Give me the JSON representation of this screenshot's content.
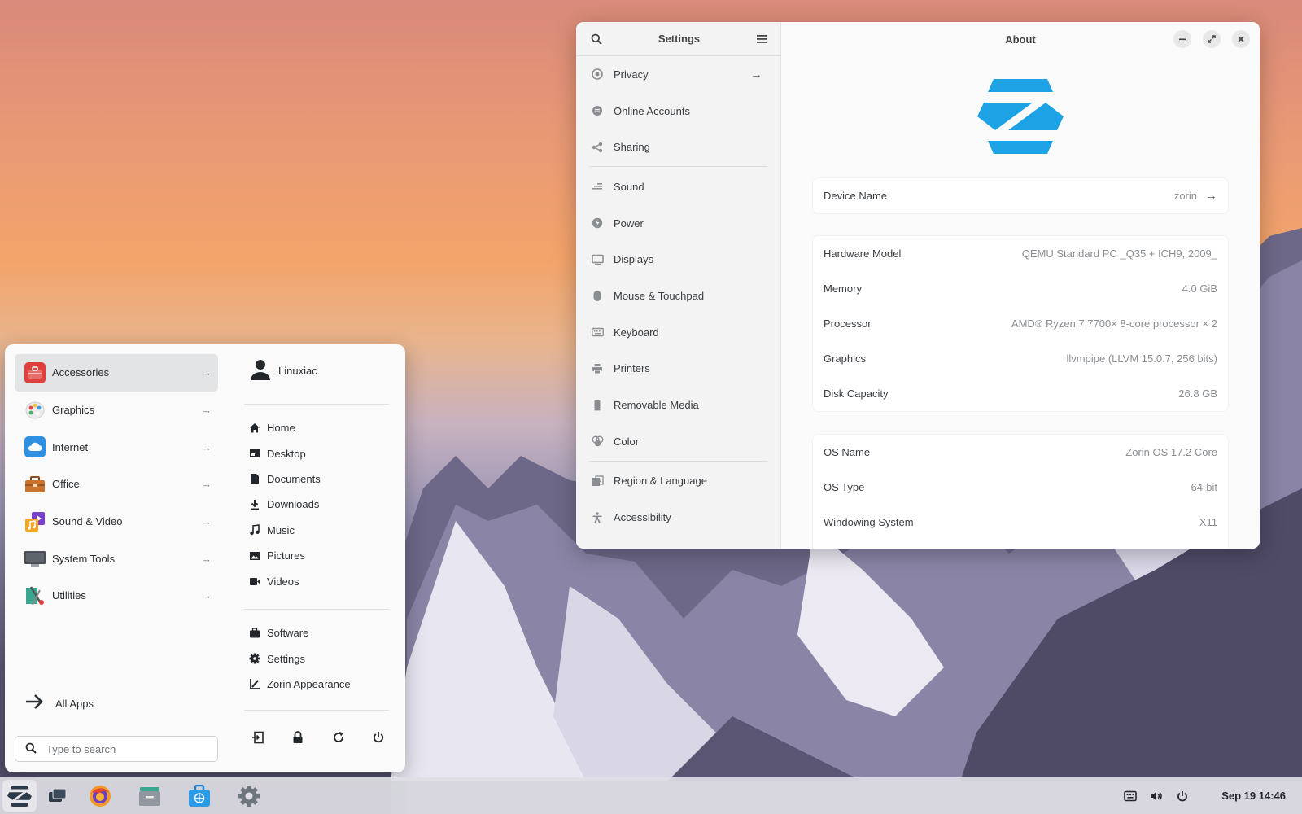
{
  "settings": {
    "sidebar_title": "Settings",
    "main_title": "About",
    "nav": [
      {
        "label": "Privacy",
        "icon": "privacy-icon"
      },
      {
        "label": "Online Accounts",
        "icon": "online-accounts-icon"
      },
      {
        "label": "Sharing",
        "icon": "share-icon"
      },
      {
        "label": "Sound",
        "icon": "sound-icon"
      },
      {
        "label": "Power",
        "icon": "power-icon"
      },
      {
        "label": "Displays",
        "icon": "display-icon"
      },
      {
        "label": "Mouse & Touchpad",
        "icon": "mouse-icon"
      },
      {
        "label": "Keyboard",
        "icon": "keyboard-icon"
      },
      {
        "label": "Printers",
        "icon": "printer-icon"
      },
      {
        "label": "Removable Media",
        "icon": "removable-media-icon"
      },
      {
        "label": "Color",
        "icon": "color-icon"
      },
      {
        "label": "Region & Language",
        "icon": "region-icon"
      },
      {
        "label": "Accessibility",
        "icon": "accessibility-icon"
      }
    ],
    "device": {
      "label": "Device Name",
      "value": "zorin"
    },
    "hardware": [
      {
        "label": "Hardware Model",
        "value": "QEMU Standard PC _Q35 + ICH9, 2009_"
      },
      {
        "label": "Memory",
        "value": "4.0 GiB"
      },
      {
        "label": "Processor",
        "value": "AMD® Ryzen 7 7700× 8-core processor × 2"
      },
      {
        "label": "Graphics",
        "value": "llvmpipe (LLVM 15.0.7, 256 bits)"
      },
      {
        "label": "Disk Capacity",
        "value": "26.8 GB"
      }
    ],
    "os": [
      {
        "label": "OS Name",
        "value": "Zorin OS 17.2 Core"
      },
      {
        "label": "OS Type",
        "value": "64-bit"
      },
      {
        "label": "Windowing System",
        "value": "X11"
      }
    ]
  },
  "start_menu": {
    "categories": [
      {
        "label": "Accessories",
        "icon": "accessories-icon",
        "color": "#e0403c"
      },
      {
        "label": "Graphics",
        "icon": "graphics-icon",
        "color": "#f2f2f2"
      },
      {
        "label": "Internet",
        "icon": "internet-icon",
        "color": "#2f8fe0"
      },
      {
        "label": "Office",
        "icon": "office-icon",
        "color": "#c8742e"
      },
      {
        "label": "Sound & Video",
        "icon": "sound-video-icon",
        "color": "#7a3fd0"
      },
      {
        "label": "System Tools",
        "icon": "system-tools-icon",
        "color": "#4a4f55"
      },
      {
        "label": "Utilities",
        "icon": "utilities-icon",
        "color": "#3aa68f"
      }
    ],
    "all_apps": "All Apps",
    "search_placeholder": "Type to search",
    "user": "Linuxiac",
    "places": [
      "Home",
      "Desktop",
      "Documents",
      "Downloads",
      "Music",
      "Pictures",
      "Videos"
    ],
    "shortcuts": [
      "Software",
      "Settings",
      "Zorin Appearance"
    ]
  },
  "taskbar": {
    "apps": [
      "zorin-menu-icon",
      "workspace-switcher-icon",
      "firefox-icon",
      "files-icon",
      "software-store-icon",
      "settings-gear-icon"
    ],
    "clock": "Sep 19  14:46"
  },
  "colors": {
    "zorin_blue": "#1ea2e6"
  }
}
